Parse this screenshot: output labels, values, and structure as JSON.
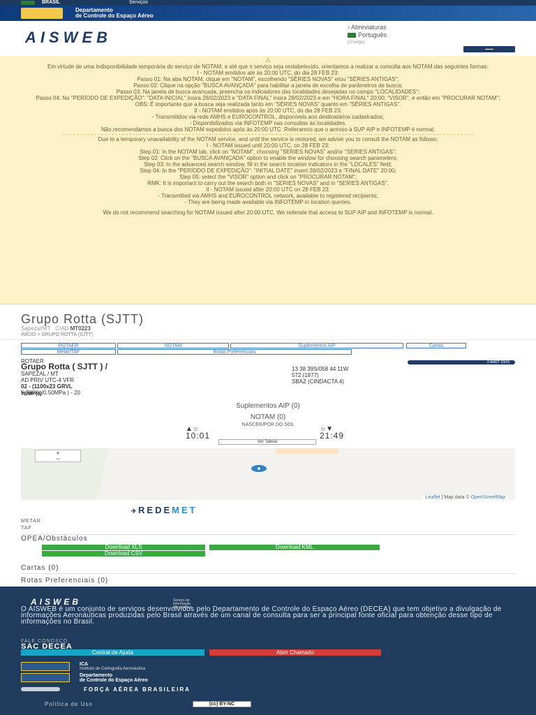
{
  "gov_bar": {
    "label": "BRASIL",
    "services": "Serviços"
  },
  "decea_header": {
    "line1": "Departamento",
    "line2": "de Controle do Espaço Aéreo"
  },
  "aisweb": {
    "logo": "AISWEB",
    "abbreviations": "Abreviaturas",
    "language": "Português",
    "change": "[Change]"
  },
  "notice_pt": [
    "Em virtude de uma indisponibilidade temporária do serviço de NOTAM, e até que o serviço seja restabelecido, orientamos a realizar a consulta aos NOTAM das seguintes formas:",
    "I - NOTAM emitidos até às 20:00 UTC, do dia 28 FEB 23:",
    "Passo 01: Na aba NOTAM, clique em \"NOTAM\", escolhendo \"SÉRIES NOVAS\" e/ou \"SÉRIES ANTIGAS\";",
    "Passo 02: Clique na opção \"BUSCA AVANÇADA\" para habilitar a janela de escolha de parâmetros de busca;",
    "Passo 03: Na janela de busca avançada, preencha os indicadores das localidades desejadas no campo \"LOCALIDADES\";",
    "Passo 04: No \"PERÍODO DE EXPEDIÇÃO\": \"DATA INICIAL\" insira 28/02/2023 e \"DATA FINAL\" insira 28/02/2023 e em \"HORA FINAL\" 20:00; \"VISOR\", e então em \"PROCURAR NOTAM\";",
    "OBS: É importante que a busca seja realizada tanto em \"SÉRIES NOVAS\" quanto em \"SÉRIES ANTIGAS\".",
    "II - NOTAM emitidos após às 20:00 UTC, do dia 28 FEB 23:",
    "- Transmitidos via rede AMHS e EUROCONTROL, disponíveis aos destinatários cadastrados;",
    "- Disponibilizados via INFOTEMP nas consultas às localidades."
  ],
  "notice_pt_final": "Não recomendamos a busca dos NOTAM expedidos após às 20:00 UTC. Reiteramos que o acesso à SUP AIP e INFOTEMP é normal.",
  "notice_en": [
    "Due to a temporary unavailability of the NOTAM service, and until the service is restored, we advise you to consult the NOTAM as follows:",
    "I - NOTAM issued until 20:00 UTC, on 28 FEB 23:",
    "Step 01: In the NOTAM tab, click on \"NOTAM\", choosing \"SERIES NOVAS\" and/or \"SERIES ANTIGAS\";",
    "Step 02: Click on the \"BUSCA AVANÇADA\" option to enable the window for choosing search parameters;",
    "Step 03: In the advanced search window, fill in the search location indicators in the \"LOCALES\" field;",
    "Step 04: In the \"PERÍODO DE EXPEDIÇÃO\": \"INITIAL DATE\" insert 28/02/2023 e \"FINAL DATE\" 20:00;",
    "Step 05: select the \"VISOR\" option and click on \"PROCURAR NOTAM\";",
    "RMK: It is important to carry out the search both in \"SERIES NOVAS\" and in \"SERIES ANTIGAS\".",
    "II - NOTAM issued after 20:00 UTC on 28 FEB 23:",
    "- Transmitted via AMHS and EUROCONTROL network, available to registered recipients;",
    "- They are being made available via INFOTEMP in location queries."
  ],
  "notice_en_final": "We do not recommend searching for NOTAM issued after 20:00 UTC. We reiterate that access to SUP AIP and INFOTEMP is normal.",
  "aerodrome": {
    "title": "Grupo Rotta (SJTT)",
    "city": "Sapezal/MT",
    "ciad_label": "CIAD",
    "ciad": "MT0223",
    "breadcrumb": "INÍCIO > GRUPO ROTTA (SJTT)"
  },
  "tabs": [
    "ROTAER",
    "NOTAM",
    "Suplementos AIP",
    "Cartas",
    "Metar/TAF",
    "Rotas Preferenciais"
  ],
  "rotaer": {
    "heading": "ROTAER",
    "amdt": "0 AMDT 29/18",
    "name": "Grupo Rotta ( SJTT ) /",
    "city": "SAPEZAL / MT",
    "type": "AD PRIV UTC-4 VFR",
    "runway": "02 - (1100x23 GRVL",
    "strength": "5.700Kg/0.50MPa ) - 20",
    "coords": "13 38 39S/058 44 11W",
    "elevation": "572 (1877)",
    "region": "SBAZ (CINDACTA 4)"
  },
  "temp": "TEMP (0)",
  "sup_aip": "Suplementos AIP (0)",
  "notam_count": "NOTAM (0)",
  "sun": {
    "title": "NASCER/POR DO SOL",
    "sunrise": "10:01",
    "sunset": "21:49",
    "table_button": "Ver Tabela"
  },
  "map": {
    "zoom_in": "+",
    "zoom_out": "−",
    "leaflet": "Leaflet",
    "attribution": "| Map data ©",
    "osm": "OpenStreetMap"
  },
  "redemet": {
    "part1": "REDE",
    "part2": "MET"
  },
  "metar": "METAR",
  "taf": "TAF",
  "opea": {
    "title": "OPEA/Obstáculos",
    "xls": "Download XLS",
    "kml": "Download KML",
    "csv": "Download CSV"
  },
  "cartas": "Cartas (0)",
  "rotas": "Rotas Preferenciais (0)",
  "footer": {
    "logo": "AISWEB",
    "logo_sub1": "Serviço de",
    "logo_sub2": "Informação",
    "logo_sub3": "Aeronáutica",
    "description": "O AISWEB é um conjunto de serviços desenvolvidos pelo Departamento de Controle do Espaço Aéreo (DECEA) que tem objetivo a divulgação de informações Aeronáuticas produzidas pelo Brasil através de um canal de consulta para ser a principal fonte oficial para obtenção desse tipo de informações no Brasil.",
    "fale": "FALE CONOSCO",
    "sac": "SAC DECEA",
    "help": "Central de Ajuda",
    "ticket": "Abrir Chamado",
    "ica1": "ICA",
    "ica2": "Instituto de Cartografia Aeronáutica",
    "decea1": "Departamento",
    "decea2": "de Controle do Espaço Aéreo",
    "fab": "FORÇA AÉREA BRASILEIRA",
    "policy": "Política de Uso",
    "cc": "(cc) BY-NC"
  },
  "colors": {
    "navy": "#1f3c5c",
    "notice_bg": "#fdf2c7",
    "accent_blue": "#3b78c4",
    "green": "#3aa843",
    "cyan": "#1aa3c9",
    "red": "#d63b3b"
  }
}
